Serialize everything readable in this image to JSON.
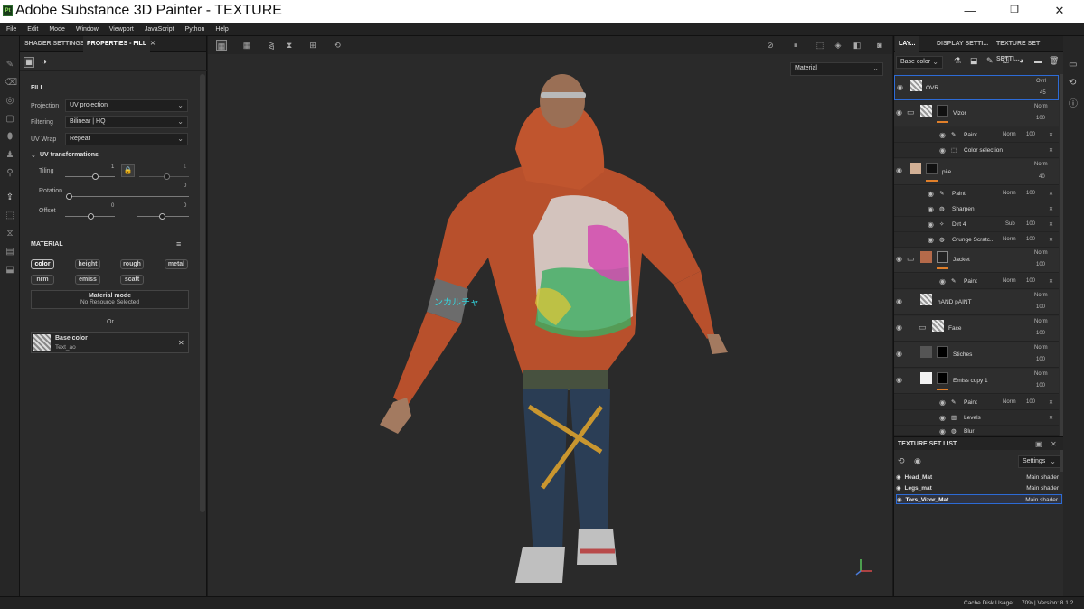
{
  "window": {
    "title": "Adobe Substance 3D Painter - TEXTURE",
    "app_icon": "Pt"
  },
  "menu": [
    "File",
    "Edit",
    "Mode",
    "Window",
    "Viewport",
    "JavaScript",
    "Python",
    "Help"
  ],
  "left_tabs": {
    "shader": "SHADER SETTINGS",
    "properties": "PROPERTIES - FILL"
  },
  "fill": {
    "header": "FILL",
    "projection_label": "Projection",
    "projection_value": "UV projection",
    "filtering_label": "Filtering",
    "filtering_value": "Bilinear | HQ",
    "uvwrap_label": "UV Wrap",
    "uvwrap_value": "Repeat",
    "uvt_header": "UV transformations",
    "tiling_label": "Tiling",
    "tiling_value": "1",
    "tiling_value2": "1",
    "rotation_label": "Rotation",
    "rotation_value": "0",
    "offset_label": "Offset",
    "offset_value1": "0",
    "offset_value2": "0"
  },
  "material": {
    "header": "MATERIAL",
    "chips": [
      "color",
      "height",
      "rough",
      "metal",
      "nrm",
      "emiss",
      "scatt"
    ],
    "mode_title": "Material mode",
    "mode_sub": "No Resource Selected",
    "or": "Or",
    "base_title": "Base color",
    "base_sub": "Text_ao"
  },
  "viewport": {
    "material_dropdown": "Material",
    "hotkey_hint": ""
  },
  "right_tabs": {
    "layers": "LAY...",
    "display": "DISPLAY SETTI...",
    "texture_set": "TEXTURE SET SETTI..."
  },
  "layers_toolbar": {
    "channel": "Base color"
  },
  "layers": [
    {
      "name": "OVR",
      "blend": "Ovrl",
      "opacity": "45"
    },
    {
      "name": "Vizor",
      "blend": "Norm",
      "opacity": "100"
    },
    {
      "name": "Paint",
      "blend": "Norm",
      "opacity": "100"
    },
    {
      "name": "Color selection"
    },
    {
      "name": "pile",
      "blend": "Norm",
      "opacity": "40"
    },
    {
      "name": "Paint",
      "blend": "Norm",
      "opacity": "100"
    },
    {
      "name": "Sharpen"
    },
    {
      "name": "Dirt 4",
      "blend": "Sub",
      "opacity": "100"
    },
    {
      "name": "Grunge Scratc...",
      "blend": "Norm",
      "opacity": "100"
    },
    {
      "name": "Jacket",
      "blend": "Norm",
      "opacity": "100"
    },
    {
      "name": "Paint",
      "blend": "Norm",
      "opacity": "100"
    },
    {
      "name": "hAND pAINT",
      "blend": "Norm",
      "opacity": "100"
    },
    {
      "name": "Face",
      "blend": "Norm",
      "opacity": "100"
    },
    {
      "name": "Stiches",
      "blend": "Norm",
      "opacity": "100"
    },
    {
      "name": "Emiss copy 1",
      "blend": "Norm",
      "opacity": "100"
    },
    {
      "name": "Paint",
      "blend": "Norm",
      "opacity": "100"
    },
    {
      "name": "Levels"
    },
    {
      "name": "Blur"
    }
  ],
  "texture_set_list": {
    "header": "TEXTURE SET LIST",
    "settings": "Settings",
    "items": [
      {
        "name": "Head_Mat",
        "shader": "Main shader"
      },
      {
        "name": "Legs_mat",
        "shader": "Main shader"
      },
      {
        "name": "Tors_Vizor_Mat",
        "shader": "Main shader"
      }
    ]
  },
  "status": {
    "cache_label": "Cache Disk Usage:",
    "cache_value": "70%",
    "version": "| Version: 8.1.2"
  },
  "colors": {
    "accent": "#e07f2a",
    "selection": "#2d6bd6",
    "jacket": "#c0552e"
  }
}
